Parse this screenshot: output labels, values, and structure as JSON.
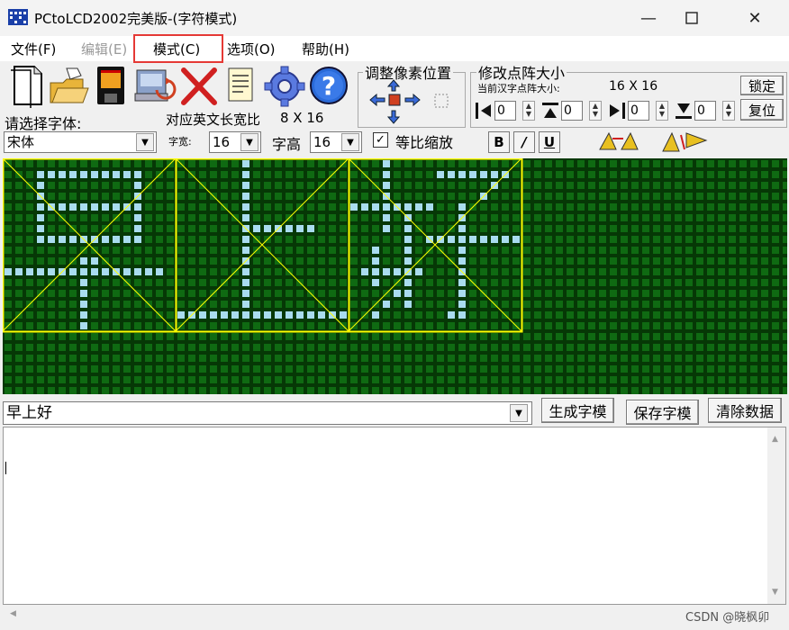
{
  "window": {
    "title": "PCtoLCD2002完美版-(字符模式)",
    "min_glyph": "—",
    "max_glyph": "☐",
    "close_glyph": "✕"
  },
  "menu": [
    {
      "label": "文件(F)",
      "enabled": true
    },
    {
      "label": "编辑(E)",
      "enabled": false
    },
    {
      "label": "模式(C)",
      "enabled": true,
      "highlighted": true
    },
    {
      "label": "选项(O)",
      "enabled": true
    },
    {
      "label": "帮助(H)",
      "enabled": true
    }
  ],
  "toolbar_icons": [
    "new-file-icon",
    "open-folder-icon",
    "save-disk-icon",
    "export-icon",
    "delete-x-icon",
    "document-icon",
    "settings-gear-icon",
    "help-question-icon"
  ],
  "adjust_group": {
    "label": "调整像素位置"
  },
  "resize_group": {
    "label": "修改点阵大小",
    "current_label": "当前汉字点阵大小:",
    "current_value": "16  X  16",
    "lock_label": "锁定",
    "reset_label": "复位",
    "spins": [
      "0",
      "0",
      "0",
      "0"
    ]
  },
  "font": {
    "select_label": "请选择字体:",
    "ratio_label": "对应英文长宽比",
    "ratio_value": "8 X 16",
    "font_value": "宋体",
    "width_label": "字宽:",
    "width_value": "16",
    "height_label": "字高",
    "height_value": "16",
    "proportional_label": "等比缩放",
    "proportional_checked": true,
    "bold_label": "B",
    "italic_label": "/",
    "underline_label": "U"
  },
  "input": {
    "text": "早上好",
    "generate_label": "生成字模",
    "save_label": "保存字模",
    "clear_label": "清除数据"
  },
  "output_text": "",
  "watermark": "CSDN @晓枫卯",
  "colors": {
    "grid_bg": "#063806",
    "grid_dot_off": "#0f6a12",
    "grid_dot_on": "#a9dcef",
    "char_frame": "#ffff00",
    "highlight": "#e53935"
  }
}
